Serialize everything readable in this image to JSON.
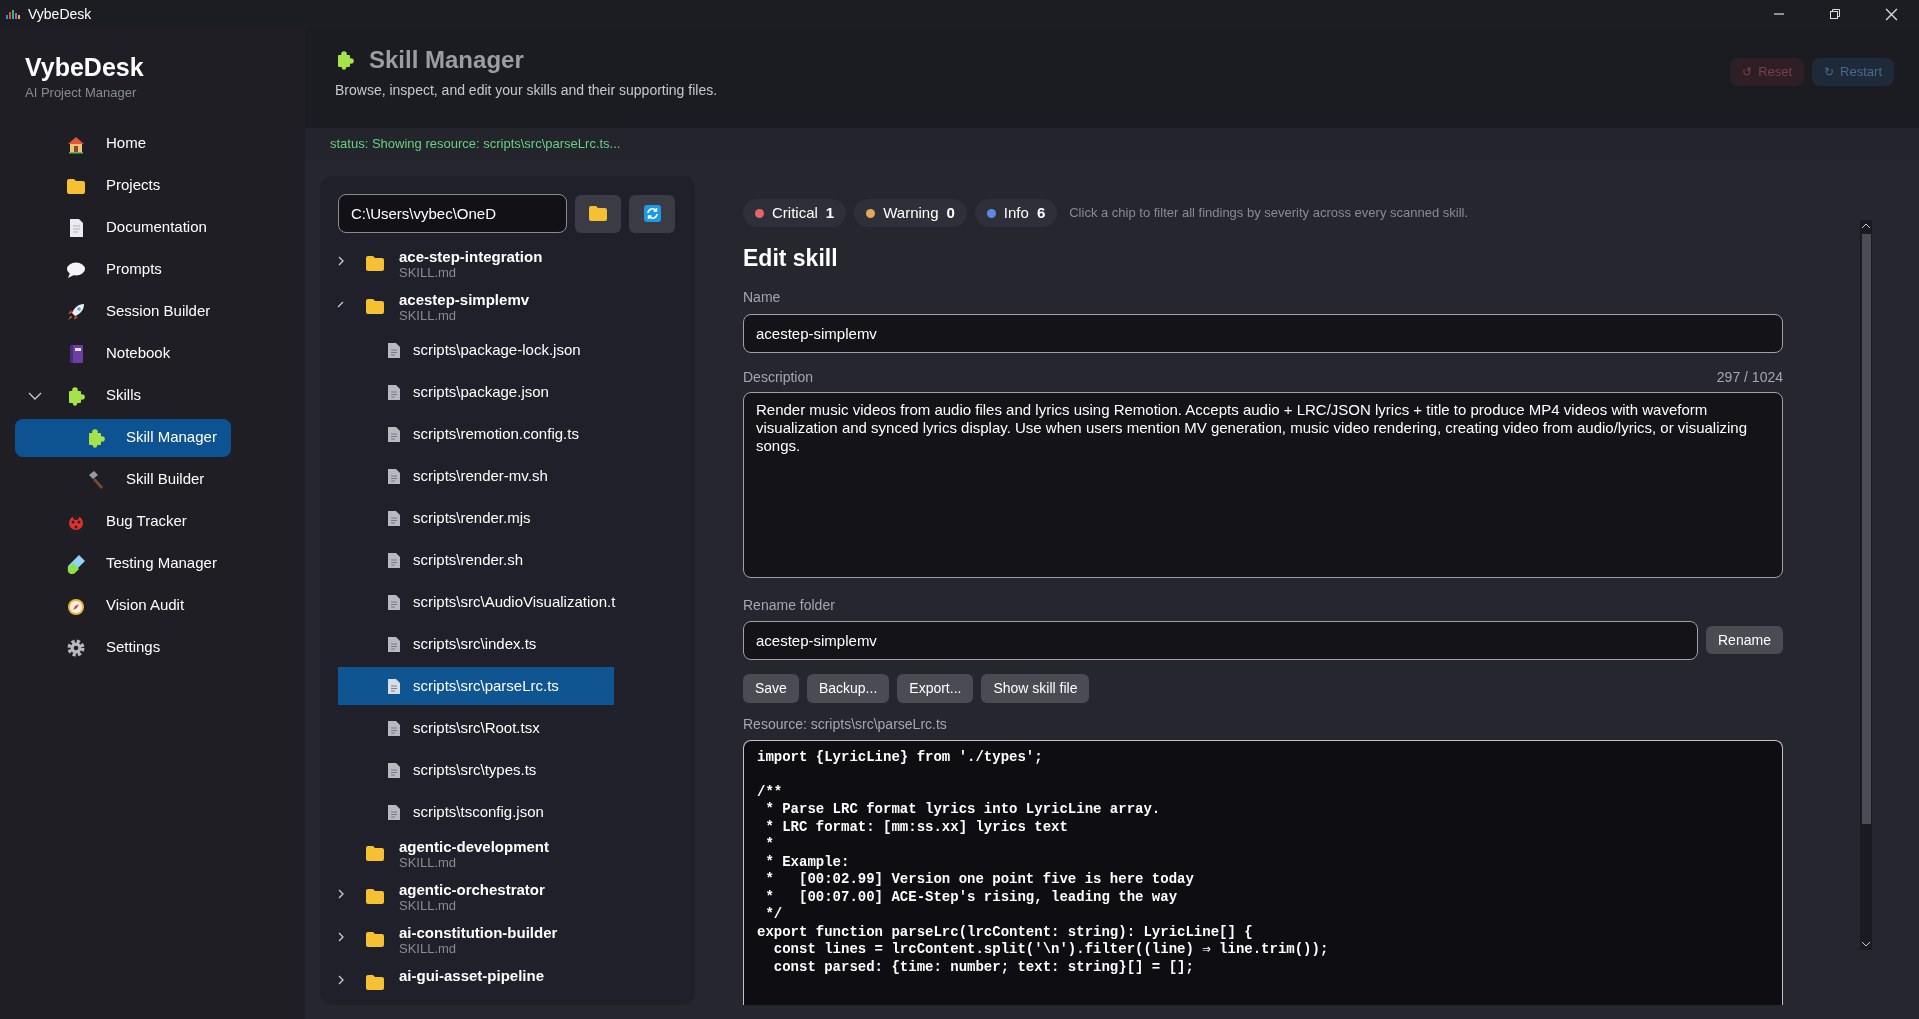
{
  "window": {
    "title": "VybeDesk"
  },
  "sidebar": {
    "brand": "VybeDesk",
    "subtitle": "AI Project Manager",
    "items": [
      {
        "label": "Home",
        "selected": false
      },
      {
        "label": "Projects",
        "selected": false
      },
      {
        "label": "Documentation",
        "selected": false
      },
      {
        "label": "Prompts",
        "selected": false
      },
      {
        "label": "Session Builder",
        "selected": false
      },
      {
        "label": "Notebook",
        "selected": false
      },
      {
        "label": "Skills",
        "selected": false,
        "expanded": true,
        "children": [
          {
            "label": "Skill Manager",
            "selected": true
          },
          {
            "label": "Skill Builder",
            "selected": false
          }
        ]
      },
      {
        "label": "Bug Tracker",
        "selected": false
      },
      {
        "label": "Testing Manager",
        "selected": false
      },
      {
        "label": "Vision Audit",
        "selected": false
      },
      {
        "label": "Settings",
        "selected": false
      }
    ]
  },
  "header": {
    "title": "Skill Manager",
    "subtitle": "Browse, inspect, and edit your skills and their supporting files.",
    "buttons": [
      {
        "label": "Reset",
        "icon": "↺",
        "kind": "danger",
        "disabled": true
      },
      {
        "label": "Restart",
        "icon": "↻",
        "kind": "primary",
        "disabled": true
      }
    ]
  },
  "status_bar": "status: Showing resource: scripts\\src\\parseLrc.ts...",
  "browser": {
    "path": "C:\\Users\\vybec\\OneD",
    "tree": [
      {
        "name": "ace-step-integration",
        "file": "SKILL.md",
        "expanded": false
      },
      {
        "name": "acestep-simplemv",
        "file": "SKILL.md",
        "expanded": true,
        "children": [
          {
            "name": "scripts\\package-lock.json",
            "selected": false
          },
          {
            "name": "scripts\\package.json",
            "selected": false
          },
          {
            "name": "scripts\\remotion.config.ts",
            "selected": false
          },
          {
            "name": "scripts\\render-mv.sh",
            "selected": false
          },
          {
            "name": "scripts\\render.mjs",
            "selected": false
          },
          {
            "name": "scripts\\render.sh",
            "selected": false
          },
          {
            "name": "scripts\\src\\AudioVisualization.t",
            "selected": false
          },
          {
            "name": "scripts\\src\\index.ts",
            "selected": false
          },
          {
            "name": "scripts\\src\\parseLrc.ts",
            "selected": true
          },
          {
            "name": "scripts\\src\\Root.tsx",
            "selected": false
          },
          {
            "name": "scripts\\src\\types.ts",
            "selected": false
          },
          {
            "name": "scripts\\tsconfig.json",
            "selected": false
          }
        ]
      },
      {
        "name": "agentic-development",
        "file": "SKILL.md"
      },
      {
        "name": "agentic-orchestrator",
        "file": "SKILL.md",
        "expanded": false
      },
      {
        "name": "ai-constitution-builder",
        "file": "SKILL.md",
        "expanded": false
      },
      {
        "name": "ai-gui-asset-pipeline",
        "expanded": false
      }
    ]
  },
  "chips": [
    {
      "label": "Critical",
      "count": "1",
      "color": "#e5636b"
    },
    {
      "label": "Warning",
      "count": "0",
      "color": "#e0a85a"
    },
    {
      "label": "Info",
      "count": "6",
      "color": "#5b8ae6"
    }
  ],
  "chips_hint": "Click a chip to filter all findings by severity across every scanned skill.",
  "editor": {
    "heading": "Edit skill",
    "name_label": "Name",
    "name": "acestep-simplemv",
    "description_label": "Description",
    "description_count": "297 / 1024",
    "description": "Render music videos from audio files and lyrics using Remotion. Accepts audio + LRC/JSON lyrics + title to produce MP4 videos with waveform visualization and synced lyrics display. Use when users mention MV generation, music video rendering, creating video from audio/lyrics, or visualizing songs.",
    "rename_label": "Rename folder",
    "rename_value": "acestep-simplemv",
    "rename_button": "Rename",
    "actions": [
      "Save",
      "Backup...",
      "Export...",
      "Show skill file"
    ],
    "resource_label": "Resource: scripts\\src\\parseLrc.ts",
    "code": "import {LyricLine} from './types';\n\n/**\n * Parse LRC format lyrics into LyricLine array.\n * LRC format: [mm:ss.xx] lyrics text\n *\n * Example:\n *   [00:02.99] Version one point five is here today\n *   [00:07.00] ACE-Step's rising, leading the way\n */\nexport function parseLrc(lrcContent: string): LyricLine[] {\n  const lines = lrcContent.split('\\n').filter((line) ⇒ line.trim());\n  const parsed: {time: number; text: string}[] = [];"
  }
}
